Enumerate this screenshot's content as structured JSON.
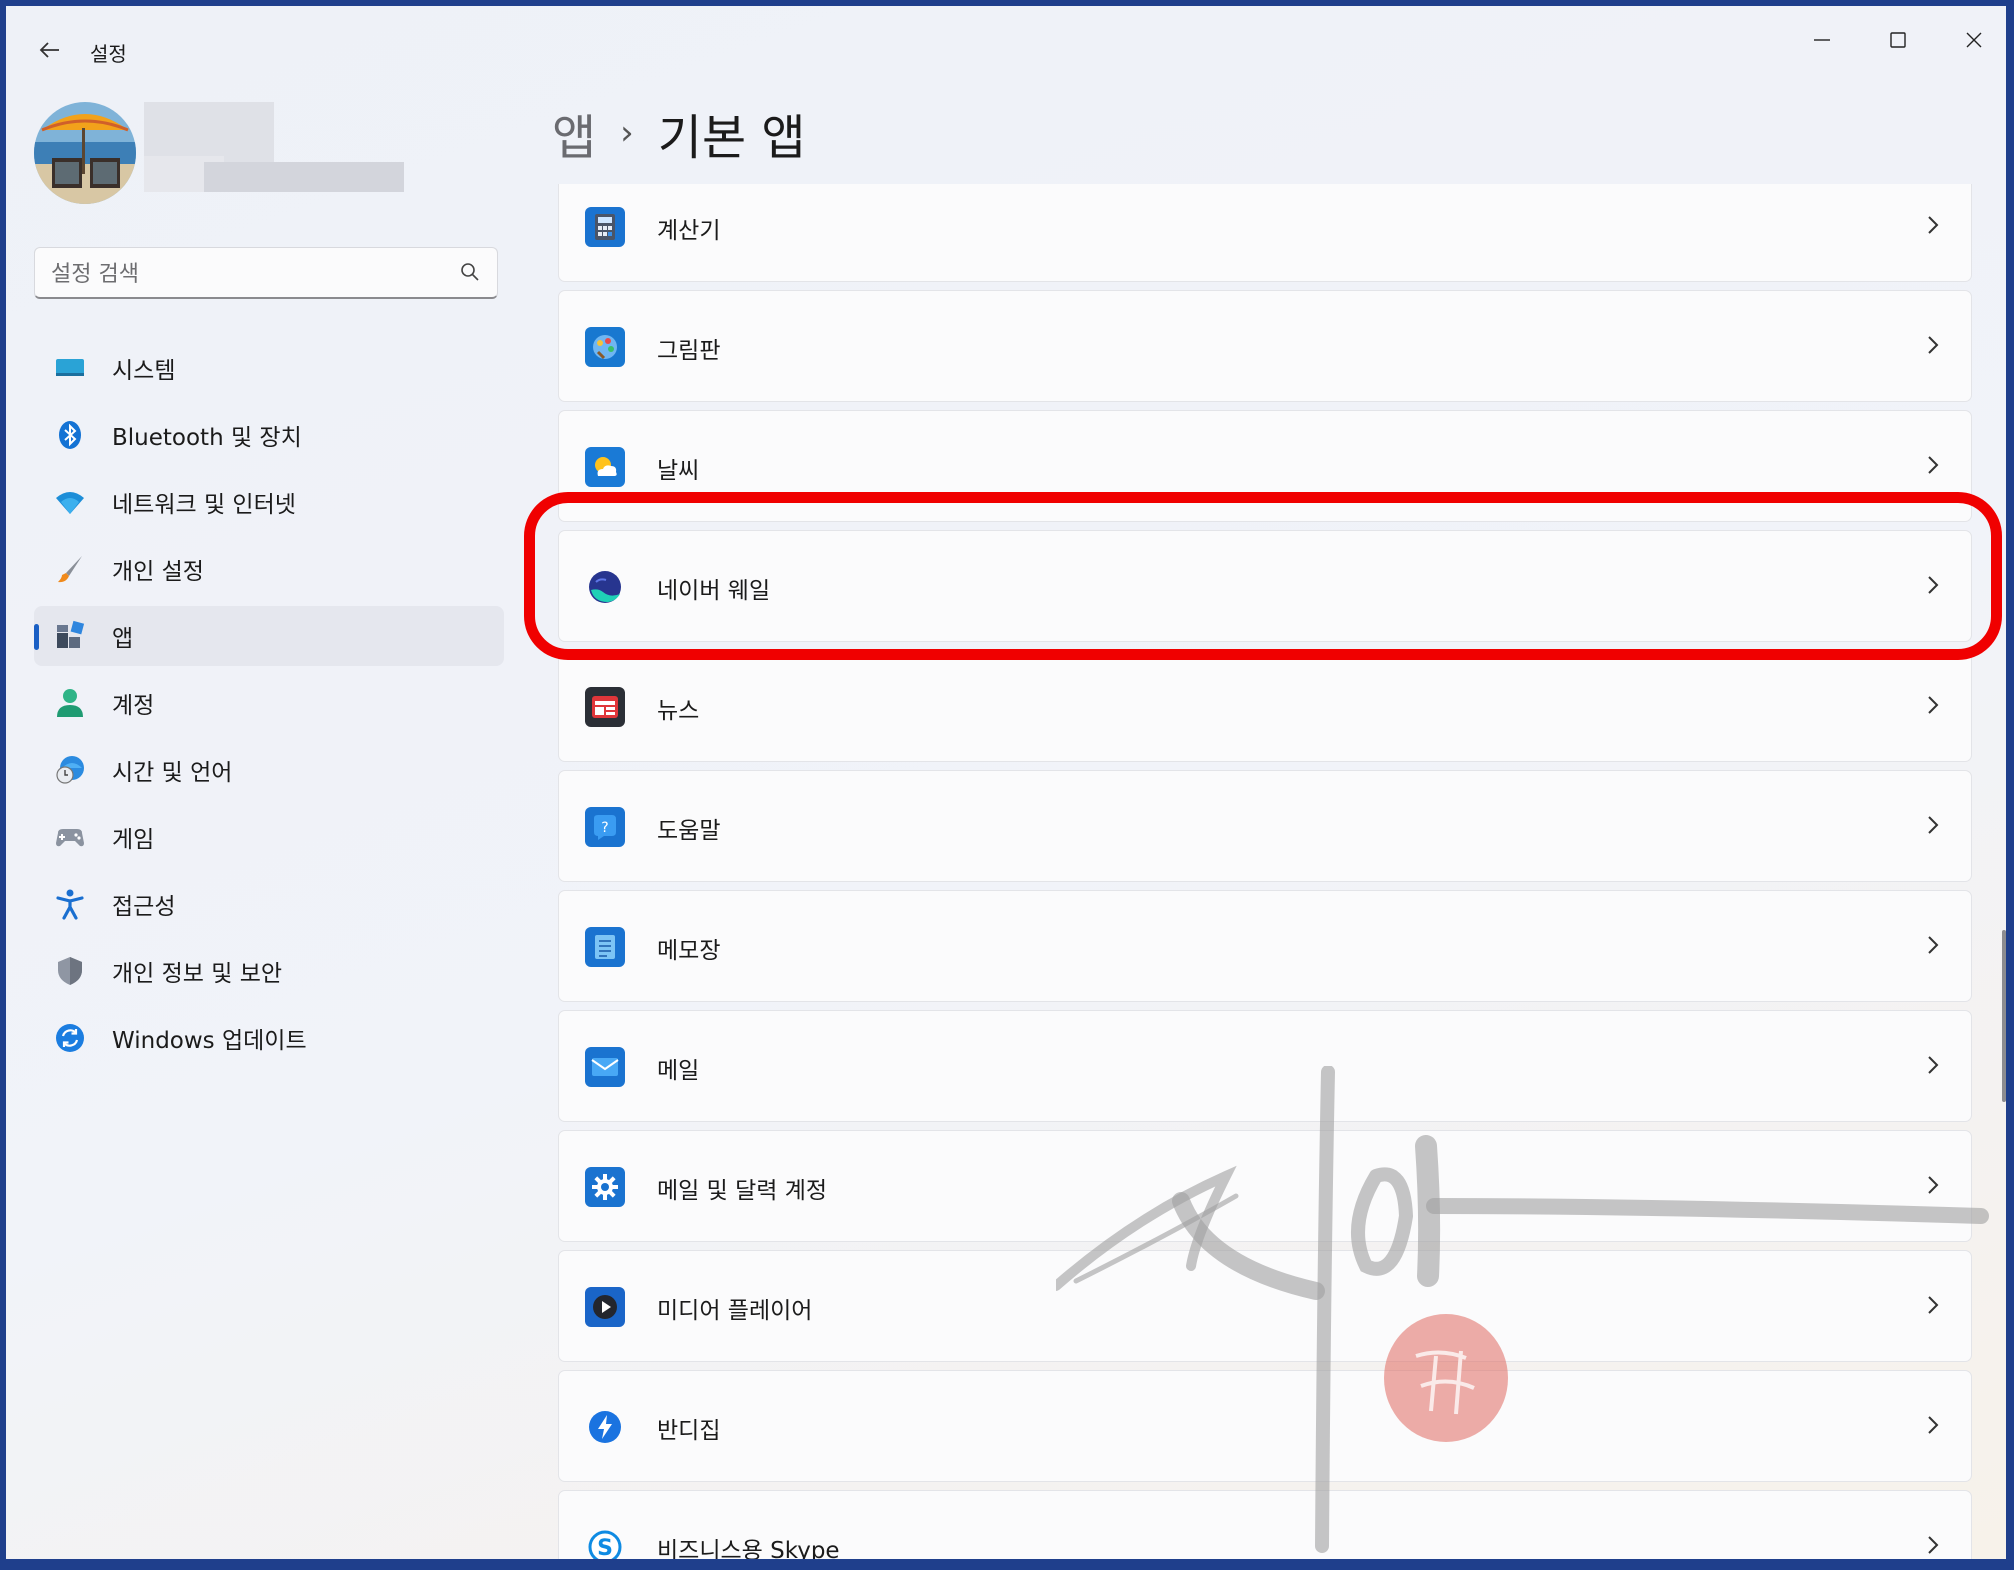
{
  "window": {
    "title": "설정",
    "controls": {
      "minimize": "minimize-icon",
      "maximize": "maximize-icon",
      "close": "close-icon"
    }
  },
  "search": {
    "placeholder": "설정 검색"
  },
  "sidebar": {
    "items": [
      {
        "label": "시스템",
        "icon": "monitor-icon",
        "active": false
      },
      {
        "label": "Bluetooth 및 장치",
        "icon": "bluetooth-icon",
        "active": false
      },
      {
        "label": "네트워크 및 인터넷",
        "icon": "wifi-icon",
        "active": false
      },
      {
        "label": "개인 설정",
        "icon": "paintbrush-icon",
        "active": false
      },
      {
        "label": "앱",
        "icon": "apps-icon",
        "active": true
      },
      {
        "label": "계정",
        "icon": "person-icon",
        "active": false
      },
      {
        "label": "시간 및 언어",
        "icon": "clock-globe-icon",
        "active": false
      },
      {
        "label": "게임",
        "icon": "gamepad-icon",
        "active": false
      },
      {
        "label": "접근성",
        "icon": "accessibility-icon",
        "active": false
      },
      {
        "label": "개인 정보 및 보안",
        "icon": "shield-icon",
        "active": false
      },
      {
        "label": "Windows 업데이트",
        "icon": "update-icon",
        "active": false
      }
    ]
  },
  "breadcrumb": {
    "parent": "앱",
    "separator": "›",
    "current": "기본 앱"
  },
  "apps": [
    {
      "label": "계산기",
      "icon": "calculator-icon"
    },
    {
      "label": "그림판",
      "icon": "paint-icon"
    },
    {
      "label": "날씨",
      "icon": "weather-icon"
    },
    {
      "label": "네이버 웨일",
      "icon": "whale-browser-icon"
    },
    {
      "label": "뉴스",
      "icon": "news-icon"
    },
    {
      "label": "도움말",
      "icon": "help-icon"
    },
    {
      "label": "메모장",
      "icon": "notepad-icon"
    },
    {
      "label": "메일",
      "icon": "mail-icon"
    },
    {
      "label": "메일 및 달력 계정",
      "icon": "gear-icon"
    },
    {
      "label": "미디어 플레이어",
      "icon": "media-player-icon"
    },
    {
      "label": "반디집",
      "icon": "bandizip-icon"
    },
    {
      "label": "비즈니스용 Skype",
      "icon": "skype-icon"
    }
  ],
  "colors": {
    "accent": "#1a5fc4",
    "highlight": "#f00000",
    "frame": "#1f3f8c"
  }
}
